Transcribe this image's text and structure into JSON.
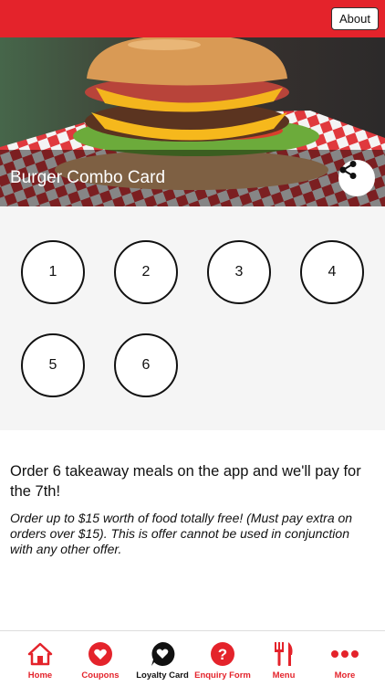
{
  "header": {
    "about_label": "About"
  },
  "hero": {
    "title": "Burger Combo Card",
    "share_icon": "share-icon"
  },
  "stamps": [
    "1",
    "2",
    "3",
    "4",
    "5",
    "6"
  ],
  "description": {
    "main": "Order 6 takeaway meals on the app and we'll pay for the 7th!",
    "note": "Order up to $15 worth of food totally free! (Must pay extra on orders over $15). This is offer cannot be used in conjunction with any other offer."
  },
  "tabs": [
    {
      "label": "Home",
      "icon": "home-icon"
    },
    {
      "label": "Coupons",
      "icon": "coupons-icon"
    },
    {
      "label": "Loyalty Card",
      "icon": "loyalty-card-icon",
      "active": true
    },
    {
      "label": "Enquiry Form",
      "icon": "enquiry-form-icon"
    },
    {
      "label": "Menu",
      "icon": "menu-icon"
    },
    {
      "label": "More",
      "icon": "more-icon"
    }
  ],
  "colors": {
    "brand_red": "#e4232b",
    "active_tab": "#111111"
  }
}
